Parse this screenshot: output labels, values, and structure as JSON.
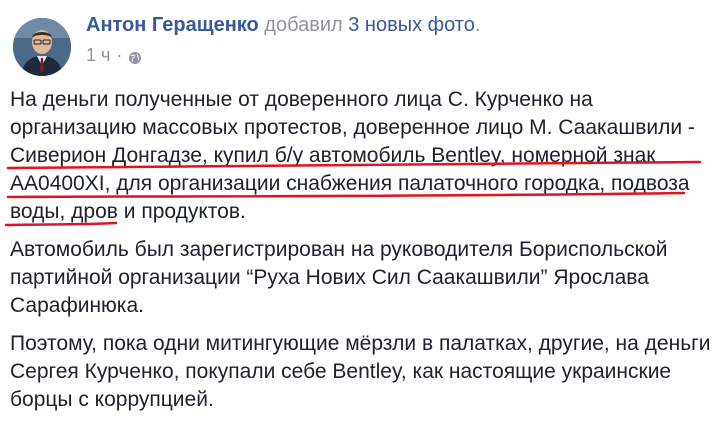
{
  "post": {
    "author_name": "Антон Геращенко",
    "action_text": " добавил ",
    "photos_text": "3 новых фото",
    "action_suffix": ".",
    "time": "1 ч",
    "dot": "·",
    "privacy_icon": "globe-icon",
    "paragraphs": [
      "На деньги полученные от доверенного лица С. Курченко на организацию массовых протестов, доверенное лицо М. Саакашвили - Сиверион Донгадзе, купил б/у автомобиль Bentley, номерной знак АА0400XI, для организации снабжения палаточного городка, подвоза воды, дров и продуктов.",
      "Автомобиль был зарегистрирован на руководителя Бориспольской партийной организации “Руха Нових Сил Саакашвили” Ярослава Сарафинюка.",
      "Поэтому, пока одни митингующие мёрзли в палатках, другие, на деньги Сергея Курченко, покупали себе Bentley, как настоящие украинские борцы с коррупцией."
    ]
  },
  "colors": {
    "link": "#385898",
    "meta": "#90949c",
    "text": "#1d2129",
    "underline": "#e2131f"
  }
}
